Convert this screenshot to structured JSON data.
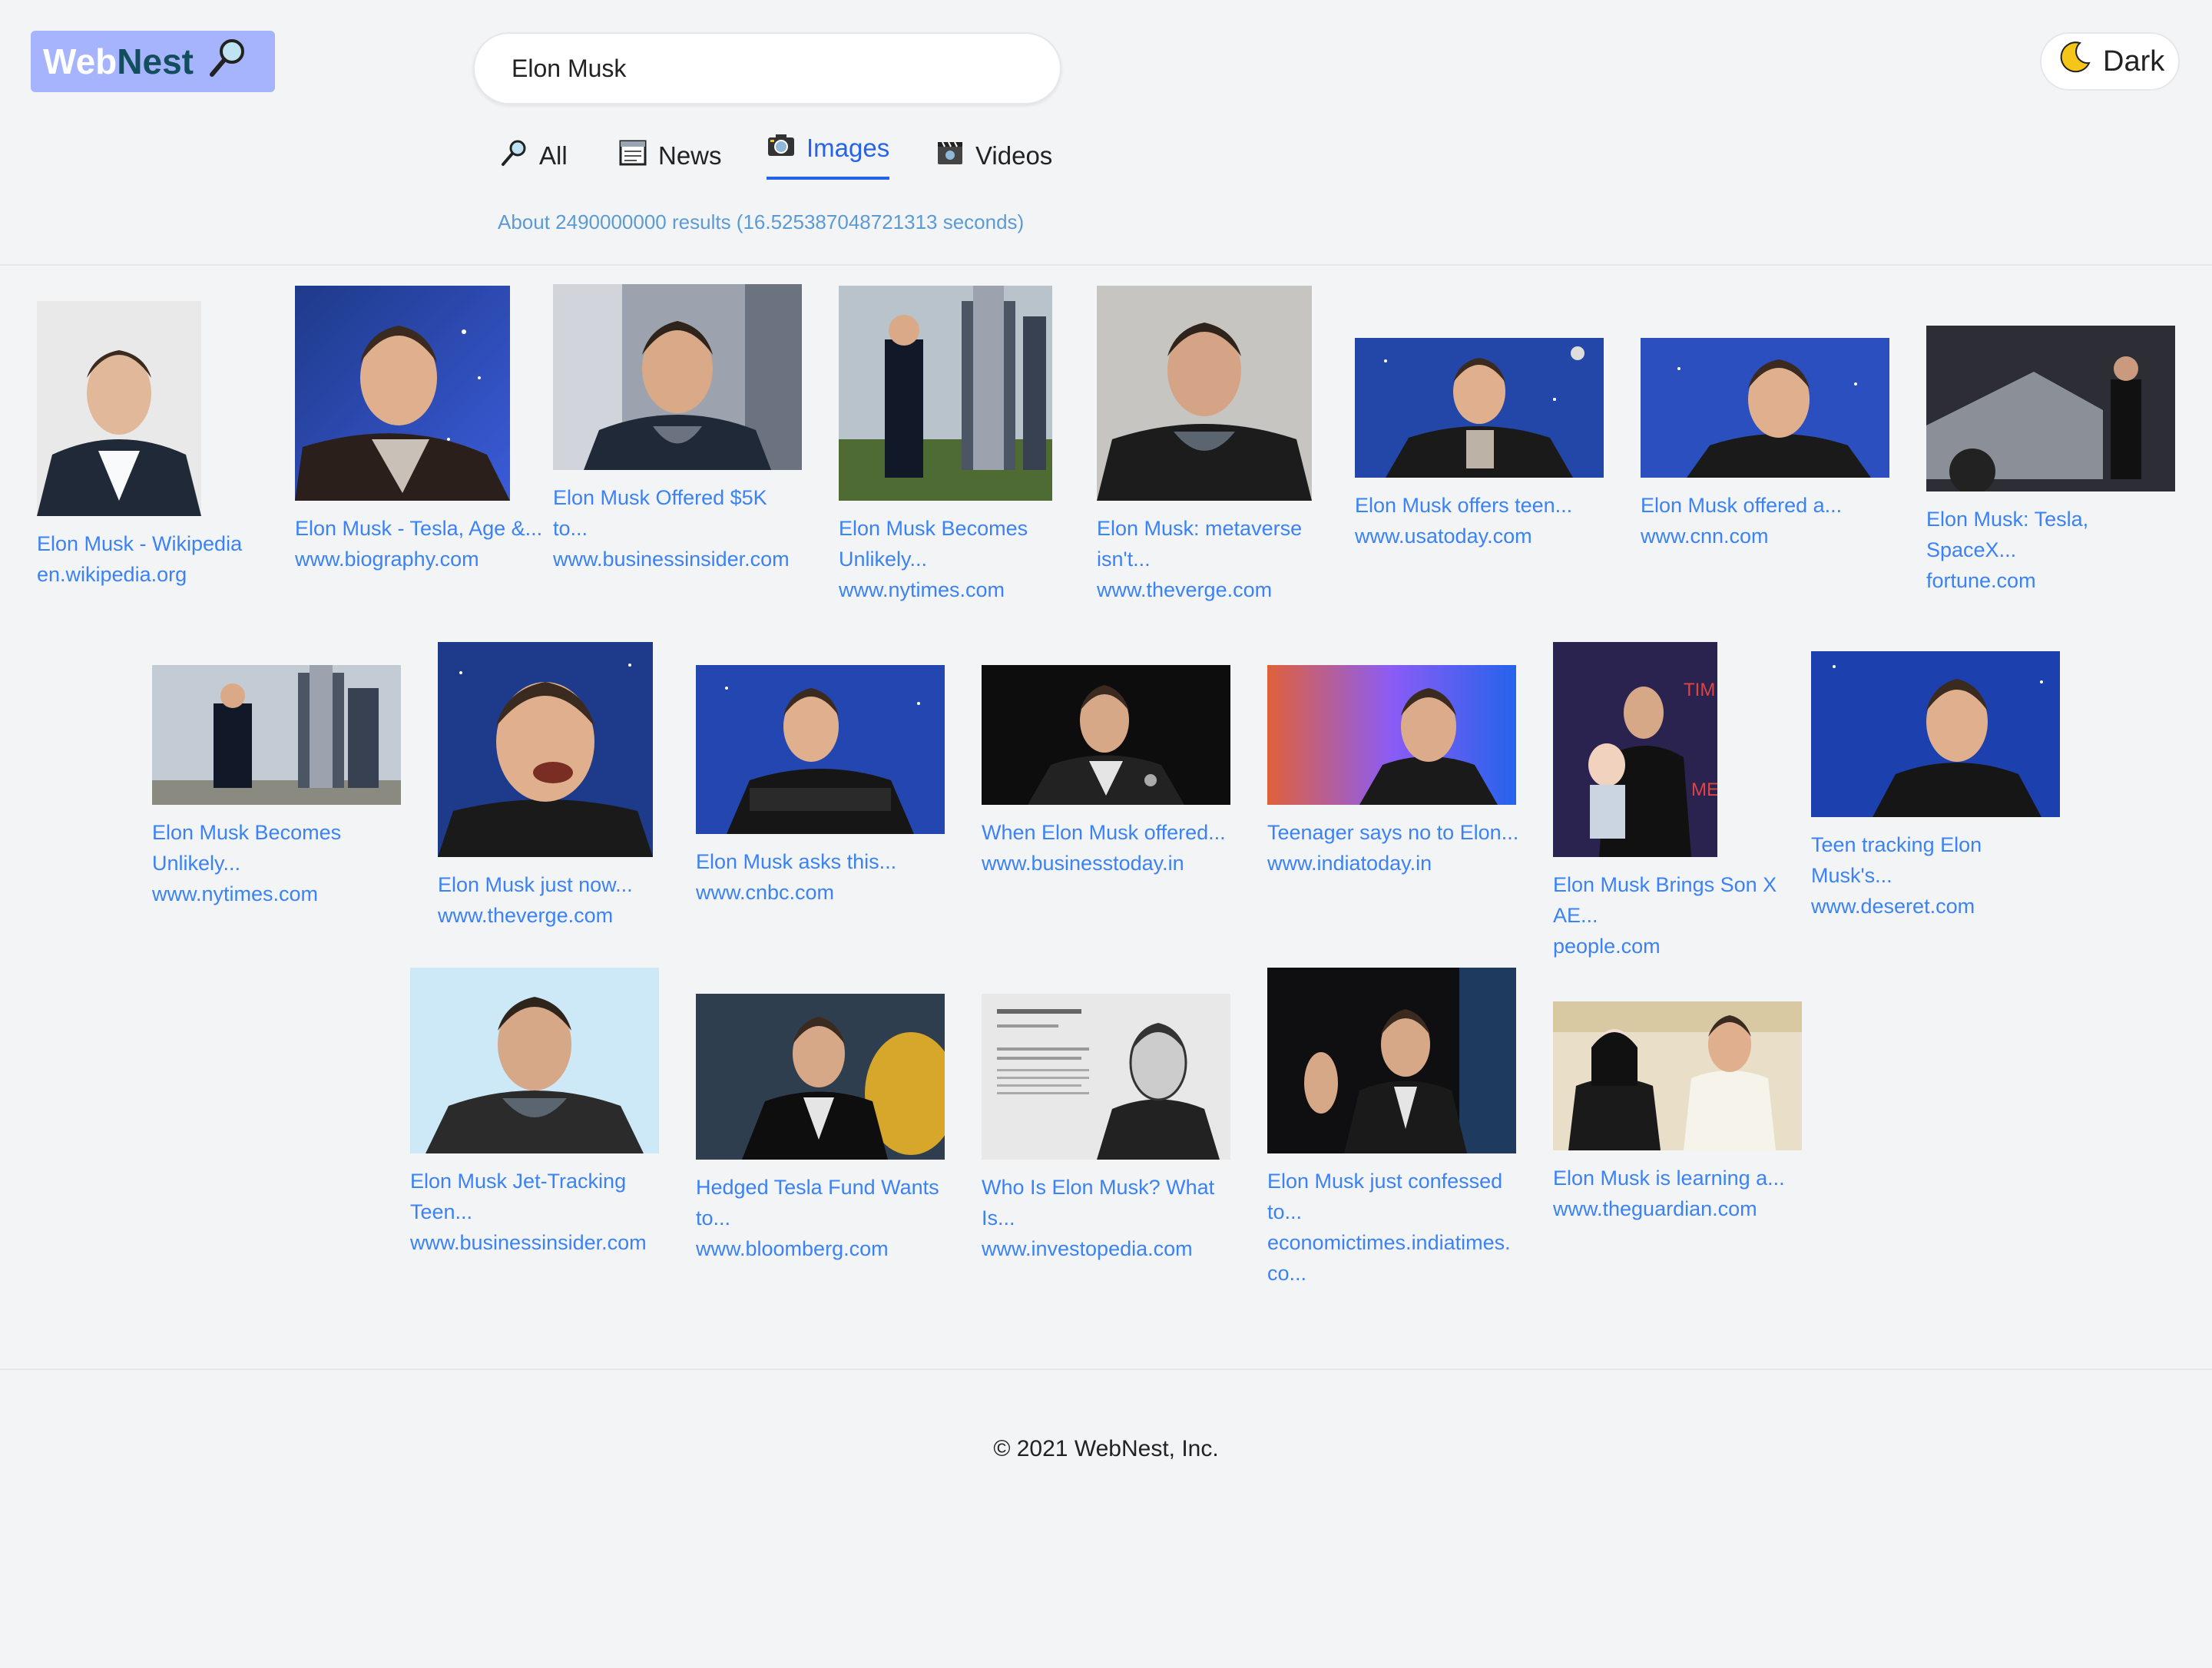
{
  "logo": {
    "part1": "Web",
    "part2": "Nest",
    "icon": "magnifier-icon"
  },
  "search": {
    "value": "Elon Musk"
  },
  "theme_toggle": {
    "label": "Dark",
    "icon": "moon-icon"
  },
  "tabs": [
    {
      "label": "All",
      "icon": "magnifier-icon",
      "active": false
    },
    {
      "label": "News",
      "icon": "newspaper-icon",
      "active": false
    },
    {
      "label": "Images",
      "icon": "camera-icon",
      "active": true
    },
    {
      "label": "Videos",
      "icon": "video-camera-icon",
      "active": false
    }
  ],
  "stats": "About 2490000000 results (16.525387048721313 seconds)",
  "results": [
    {
      "title": "Elon Musk - Wikipedia",
      "source": "en.wikipedia.org"
    },
    {
      "title": "Elon Musk - Tesla, Age &...",
      "source": "www.biography.com"
    },
    {
      "title": "Elon Musk Offered $5K to...",
      "source": "www.businessinsider.com"
    },
    {
      "title": "Elon Musk Becomes Unlikely...",
      "source": "www.nytimes.com"
    },
    {
      "title": "Elon Musk: metaverse isn't...",
      "source": "www.theverge.com"
    },
    {
      "title": "Elon Musk offers teen...",
      "source": "www.usatoday.com"
    },
    {
      "title": "Elon Musk offered a...",
      "source": "www.cnn.com"
    },
    {
      "title": "Elon Musk: Tesla, SpaceX...",
      "source": "fortune.com"
    },
    {
      "title": "Elon Musk Becomes Unlikely...",
      "source": "www.nytimes.com"
    },
    {
      "title": "Elon Musk just now...",
      "source": "www.theverge.com"
    },
    {
      "title": "Elon Musk asks this...",
      "source": "www.cnbc.com"
    },
    {
      "title": "When Elon Musk offered...",
      "source": "www.businesstoday.in"
    },
    {
      "title": "Teenager says no to Elon...",
      "source": "www.indiatoday.in"
    },
    {
      "title": "Elon Musk Brings Son X AE...",
      "source": "people.com"
    },
    {
      "title": "Teen tracking Elon Musk's...",
      "source": "www.deseret.com"
    },
    {
      "title": "Elon Musk Jet-Tracking Teen...",
      "source": "www.businessinsider.com"
    },
    {
      "title": "Hedged Tesla Fund Wants to...",
      "source": "www.bloomberg.com"
    },
    {
      "title": "Who Is Elon Musk? What Is...",
      "source": "www.investopedia.com"
    },
    {
      "title": "Elon Musk just confessed to...",
      "source": "economictimes.indiatimes.co..."
    },
    {
      "title": "Elon Musk is learning a...",
      "source": "www.theguardian.com"
    }
  ],
  "footer": "© 2021 WebNest, Inc."
}
